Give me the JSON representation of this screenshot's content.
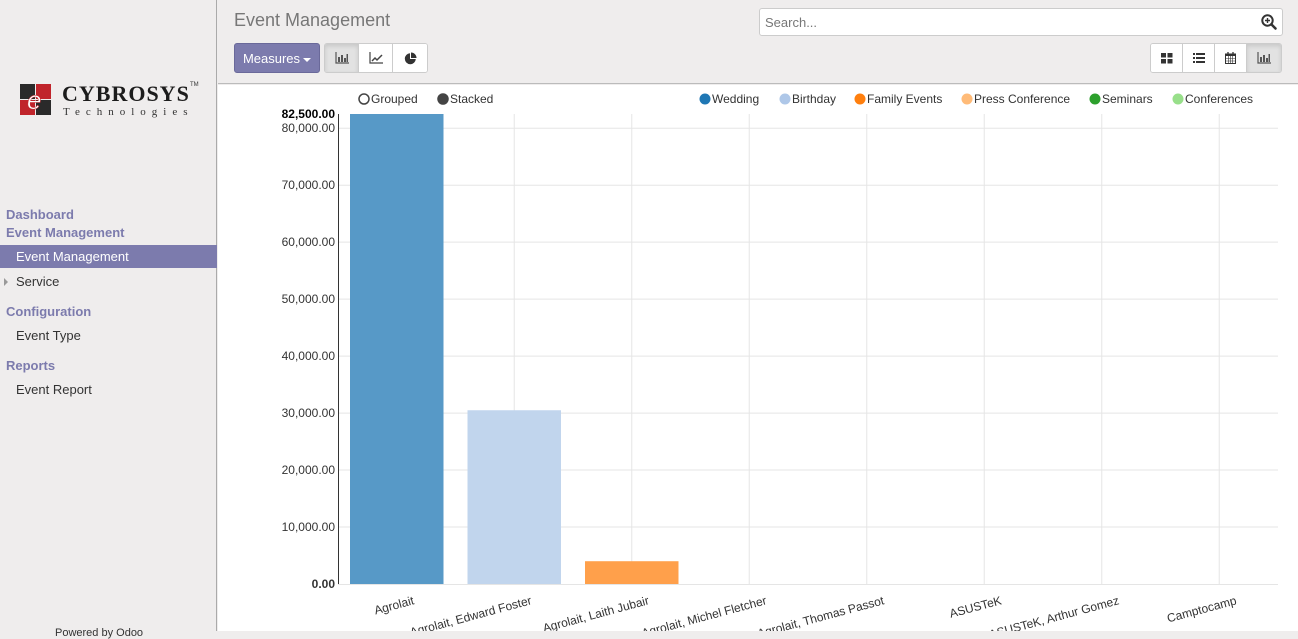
{
  "sidebar": {
    "logo": {
      "name": "CYBROSYS",
      "tm": "TM",
      "subtitle": "Technologies"
    },
    "sections": [
      {
        "label": "Dashboard"
      },
      {
        "label": "Event Management"
      },
      {
        "label": "Configuration"
      },
      {
        "label": "Reports"
      }
    ],
    "items": [
      {
        "label": "Event Management",
        "active": true
      },
      {
        "label": "Service"
      },
      {
        "label": "Event Type"
      },
      {
        "label": "Event Report"
      }
    ],
    "footer": "Powered by Odoo"
  },
  "header": {
    "title": "Event Management",
    "measures_label": "Measures",
    "search_placeholder": "Search...",
    "chart_modes": [
      "bar-chart-icon",
      "line-chart-icon",
      "pie-chart-icon"
    ],
    "active_chart_mode": "bar-chart-icon",
    "views": [
      "kanban-icon",
      "list-icon",
      "calendar-icon",
      "graph-icon"
    ],
    "active_view": "graph-icon"
  },
  "chart_data": {
    "type": "bar",
    "mode_options": [
      {
        "label": "Grouped",
        "selected": false
      },
      {
        "label": "Stacked",
        "selected": true
      }
    ],
    "categories": [
      "Agrolait",
      "Agrolait, Edward Foster",
      "Agrolait, Laith Jubair",
      "Agrolait, Michel Fletcher",
      "Agrolait, Thomas Passot",
      "ASUSTeK",
      "ASUSTeK, Arthur Gomez",
      "Camptocamp"
    ],
    "series": [
      {
        "name": "Wedding",
        "color": "#1f77b4",
        "bar_color": "#5799c7",
        "values": [
          82500,
          0,
          0,
          0,
          0,
          0,
          0,
          0
        ]
      },
      {
        "name": "Birthday",
        "color": "#aec7e8",
        "bar_color": "#c1d5ed",
        "values": [
          0,
          30500,
          0,
          0,
          0,
          0,
          0,
          0
        ]
      },
      {
        "name": "Family Events",
        "color": "#ff7f0e",
        "bar_color": "#ffa04b",
        "values": [
          0,
          0,
          4000,
          0,
          0,
          0,
          0,
          0
        ]
      },
      {
        "name": "Press Conference",
        "color": "#ffbb78",
        "bar_color": "#ffbb78",
        "values": [
          0,
          0,
          0,
          0,
          0,
          0,
          0,
          0
        ]
      },
      {
        "name": "Seminars",
        "color": "#2ca02c",
        "bar_color": "#2ca02c",
        "values": [
          0,
          0,
          0,
          0,
          0,
          0,
          0,
          0
        ]
      },
      {
        "name": "Conferences",
        "color": "#98df8a",
        "bar_color": "#98df8a",
        "values": [
          0,
          0,
          0,
          0,
          0,
          0,
          0,
          0
        ]
      }
    ],
    "y_ticks": [
      0,
      10000,
      20000,
      30000,
      40000,
      50000,
      60000,
      70000,
      80000
    ],
    "y_tick_labels": [
      "0.00",
      "10,000.00",
      "20,000.00",
      "30,000.00",
      "40,000.00",
      "50,000.00",
      "60,000.00",
      "70,000.00",
      "80,000.00"
    ],
    "y_max_label": "82,500.00",
    "ylim": [
      0,
      82500
    ],
    "grid": true,
    "legend_position": "top-right",
    "title": "",
    "xlabel": "",
    "ylabel": ""
  }
}
